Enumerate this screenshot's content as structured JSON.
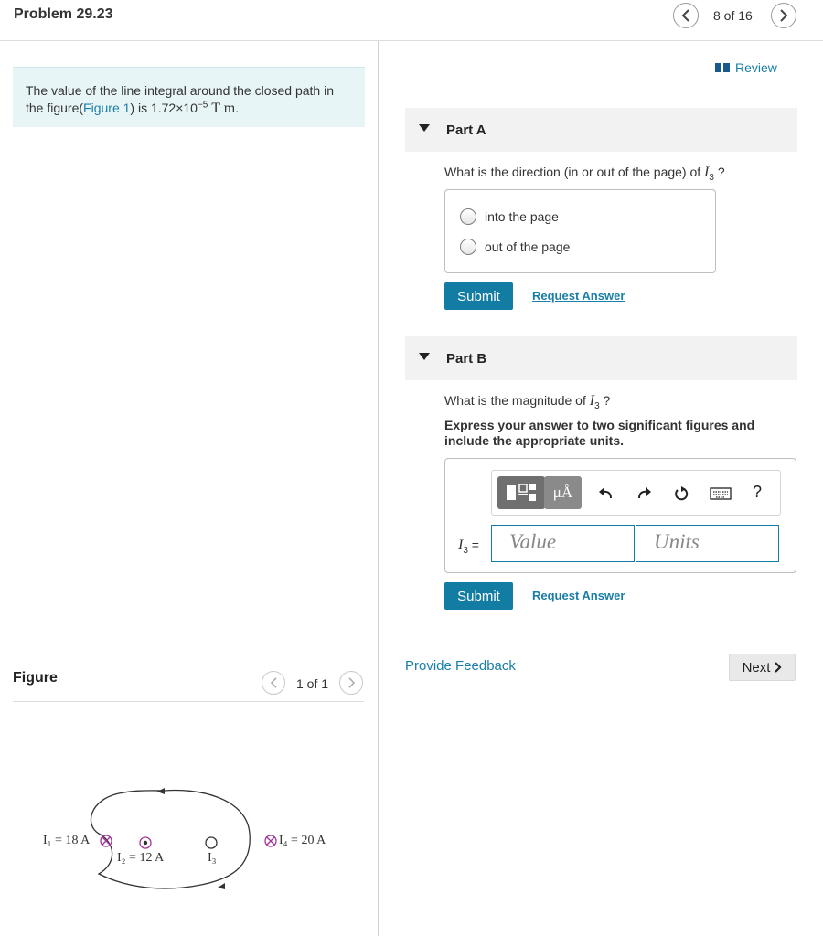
{
  "header": {
    "title": "Problem 29.23",
    "page_count": "8 of 16"
  },
  "intro": {
    "text_before": "The value of the line integral around the closed path in the figure(",
    "figure_link": "Figure 1",
    "text_after": ") is 1.72×10",
    "exponent": "−5",
    "unit": "T m",
    "period": "."
  },
  "figure": {
    "title": "Figure",
    "count": "1 of 1",
    "labels": {
      "i1": "I₁ = 18 A",
      "i2": "I₂ = 12 A",
      "i3": "I₃",
      "i4": "I₄ = 20 A"
    }
  },
  "review": {
    "label": "Review"
  },
  "partA": {
    "title": "Part A",
    "question_before": "What is the direction (in or out of the page) of ",
    "variable": "I",
    "variable_sub": "3",
    "question_after": " ?",
    "choices": [
      "into the page",
      "out of the page"
    ],
    "submit": "Submit",
    "request_answer": "Request Answer"
  },
  "partB": {
    "title": "Part B",
    "question_before": "What is the magnitude of ",
    "variable": "I",
    "variable_sub": "3",
    "question_after": " ?",
    "instruction": "Express your answer to two significant figures and include the appropriate units.",
    "toolbar": {
      "units_button": "μÅ",
      "help": "?"
    },
    "input_label_var": "I",
    "input_label_sub": "3",
    "input_label_eq": " =",
    "value_placeholder": "Value",
    "units_placeholder": "Units",
    "submit": "Submit",
    "request_answer": "Request Answer"
  },
  "footer": {
    "feedback": "Provide Feedback",
    "next": "Next"
  }
}
